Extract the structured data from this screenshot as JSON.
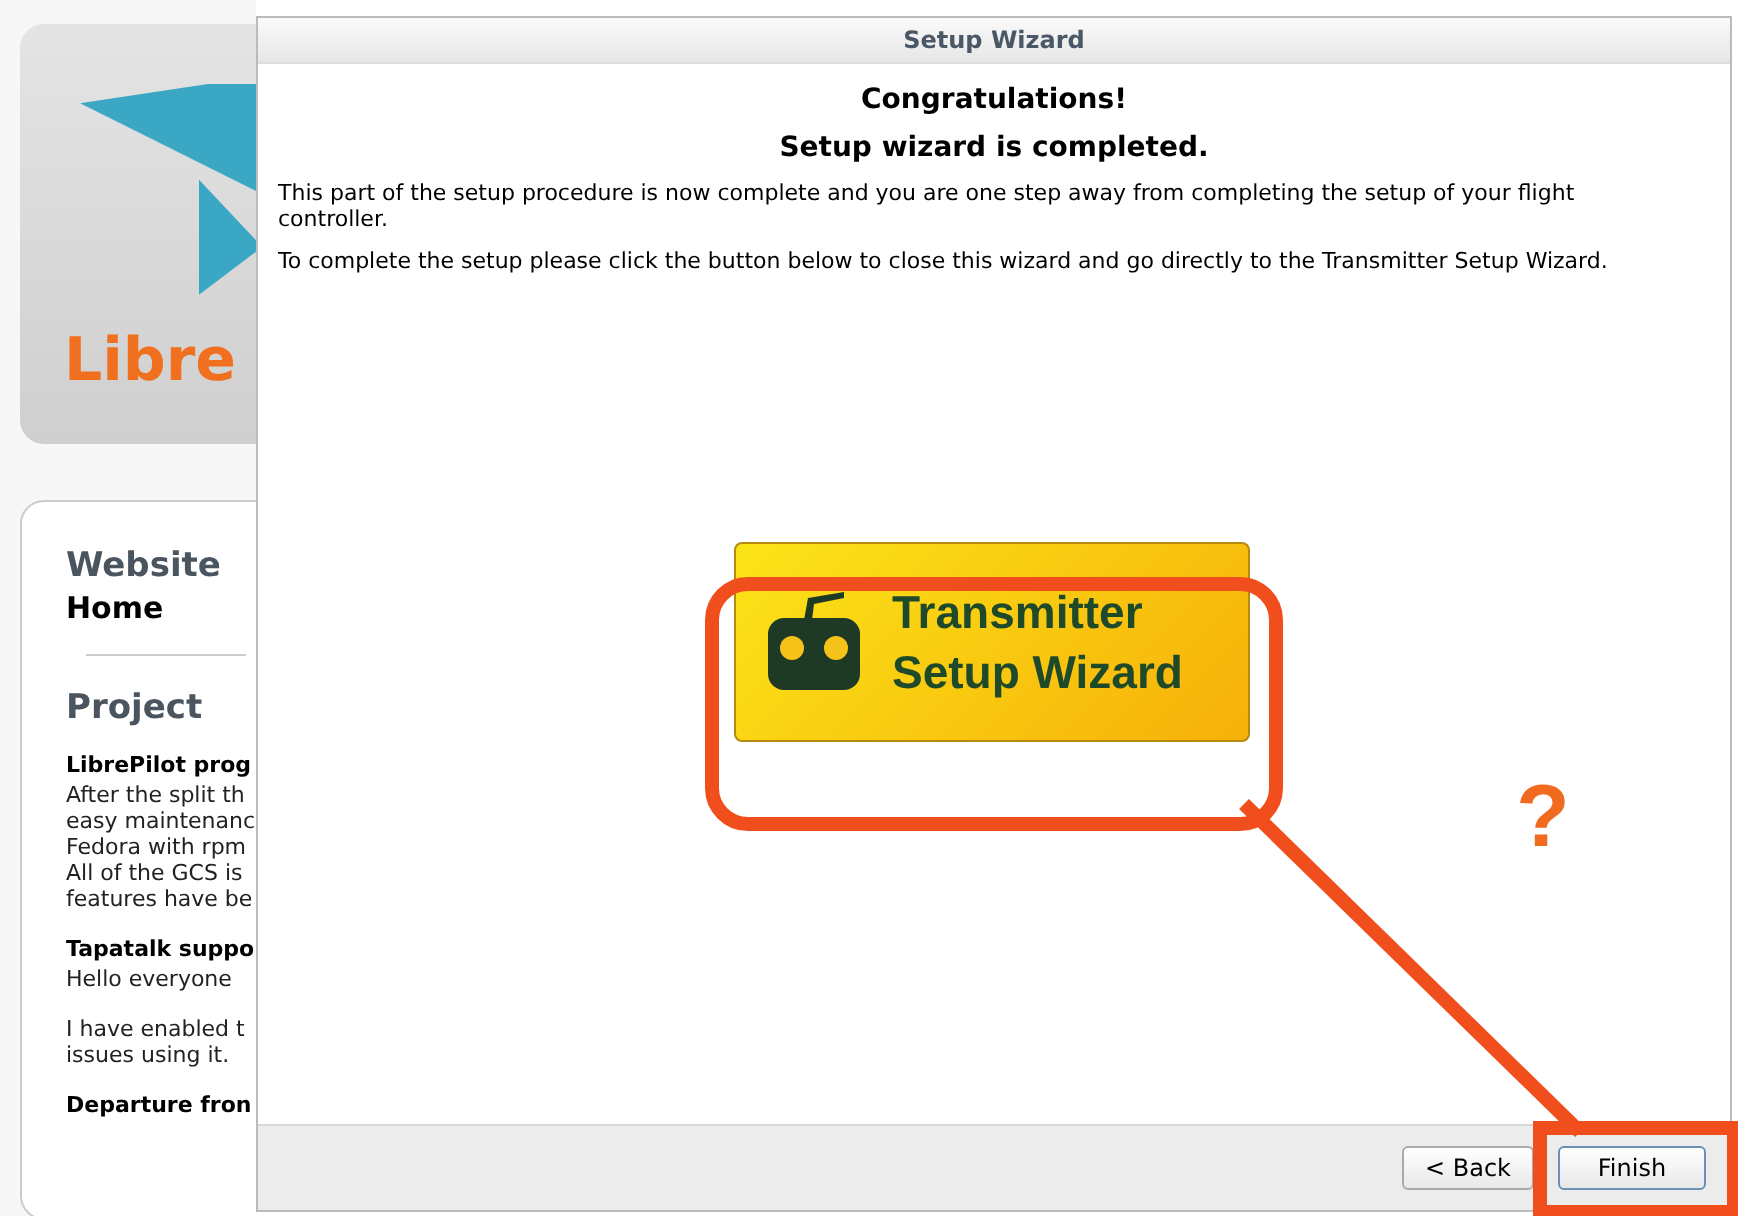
{
  "background_page": {
    "logo_text": "Libre",
    "sections": [
      {
        "kind": "heading",
        "text": "Website"
      },
      {
        "kind": "nav",
        "items": [
          "Home"
        ]
      },
      {
        "kind": "rule"
      },
      {
        "kind": "heading",
        "text": "Project"
      },
      {
        "kind": "subhead",
        "text": "LibrePilot prog"
      },
      {
        "kind": "lines",
        "items": [
          "After the split th",
          "easy maintenanc",
          "Fedora with rpm",
          "All of the GCS is",
          "features have be"
        ]
      },
      {
        "kind": "subhead",
        "text": "Tapatalk suppo"
      },
      {
        "kind": "lines",
        "items": [
          "Hello everyone"
        ]
      },
      {
        "kind": "lines",
        "items": [
          "I have enabled t",
          "issues using it."
        ]
      },
      {
        "kind": "subhead",
        "text": "Departure fron"
      }
    ]
  },
  "window": {
    "title": "Setup Wizard"
  },
  "heading": "Congratulations!",
  "subheading": "Setup wizard is completed.",
  "paragraphs": [
    "This part of the setup procedure is now complete and you are one step away from completing the setup of your flight controller.",
    "To complete the setup please click the button below to close this wizard and go directly to the Transmitter Setup Wizard."
  ],
  "transmitter_button": {
    "lines": [
      "Transmitter",
      "Setup Wizard"
    ]
  },
  "annotation": {
    "mark": "?"
  },
  "buttons": [
    {
      "label": "< Back",
      "kind": "back"
    },
    {
      "label": "Finish",
      "kind": "finish"
    }
  ]
}
